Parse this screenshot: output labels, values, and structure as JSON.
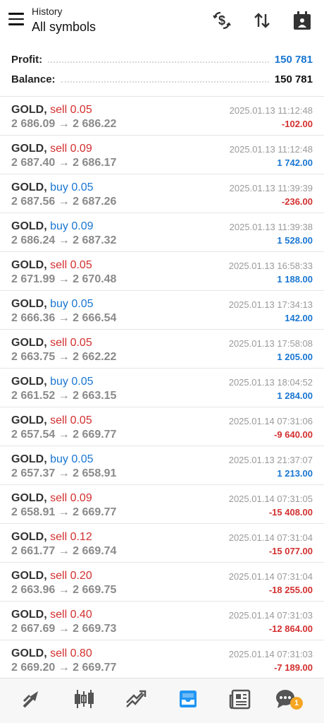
{
  "header": {
    "subtitle": "History",
    "title": "All symbols"
  },
  "summary": {
    "profit_label": "Profit:",
    "profit_value": "150 781",
    "balance_label": "Balance:",
    "balance_value": "150 781"
  },
  "deals": [
    {
      "symbol": "GOLD,",
      "side": "sell 0.05",
      "type": "sell",
      "prices": "2 686.09 → 2 686.22",
      "time": "2025.01.13 11:12:48",
      "pl": "-102.00",
      "pl_sign": "neg"
    },
    {
      "symbol": "GOLD,",
      "side": "sell 0.09",
      "type": "sell",
      "prices": "2 687.40 → 2 686.17",
      "time": "2025.01.13 11:12:48",
      "pl": "1 742.00",
      "pl_sign": "pos"
    },
    {
      "symbol": "GOLD,",
      "side": "buy 0.05",
      "type": "buy",
      "prices": "2 687.56 → 2 687.26",
      "time": "2025.01.13 11:39:39",
      "pl": "-236.00",
      "pl_sign": "neg"
    },
    {
      "symbol": "GOLD,",
      "side": "buy 0.09",
      "type": "buy",
      "prices": "2 686.24 → 2 687.32",
      "time": "2025.01.13 11:39:38",
      "pl": "1 528.00",
      "pl_sign": "pos"
    },
    {
      "symbol": "GOLD,",
      "side": "sell 0.05",
      "type": "sell",
      "prices": "2 671.99 → 2 670.48",
      "time": "2025.01.13 16:58:33",
      "pl": "1 188.00",
      "pl_sign": "pos"
    },
    {
      "symbol": "GOLD,",
      "side": "buy 0.05",
      "type": "buy",
      "prices": "2 666.36 → 2 666.54",
      "time": "2025.01.13 17:34:13",
      "pl": "142.00",
      "pl_sign": "pos"
    },
    {
      "symbol": "GOLD,",
      "side": "sell 0.05",
      "type": "sell",
      "prices": "2 663.75 → 2 662.22",
      "time": "2025.01.13 17:58:08",
      "pl": "1 205.00",
      "pl_sign": "pos"
    },
    {
      "symbol": "GOLD,",
      "side": "buy 0.05",
      "type": "buy",
      "prices": "2 661.52 → 2 663.15",
      "time": "2025.01.13 18:04:52",
      "pl": "1 284.00",
      "pl_sign": "pos"
    },
    {
      "symbol": "GOLD,",
      "side": "sell 0.05",
      "type": "sell",
      "prices": "2 657.54 → 2 669.77",
      "time": "2025.01.14 07:31:06",
      "pl": "-9 640.00",
      "pl_sign": "neg"
    },
    {
      "symbol": "GOLD,",
      "side": "buy 0.05",
      "type": "buy",
      "prices": "2 657.37 → 2 658.91",
      "time": "2025.01.13 21:37:07",
      "pl": "1 213.00",
      "pl_sign": "pos"
    },
    {
      "symbol": "GOLD,",
      "side": "sell 0.09",
      "type": "sell",
      "prices": "2 658.91 → 2 669.77",
      "time": "2025.01.14 07:31:05",
      "pl": "-15 408.00",
      "pl_sign": "neg"
    },
    {
      "symbol": "GOLD,",
      "side": "sell 0.12",
      "type": "sell",
      "prices": "2 661.77 → 2 669.74",
      "time": "2025.01.14 07:31:04",
      "pl": "-15 077.00",
      "pl_sign": "neg"
    },
    {
      "symbol": "GOLD,",
      "side": "sell 0.20",
      "type": "sell",
      "prices": "2 663.96 → 2 669.75",
      "time": "2025.01.14 07:31:04",
      "pl": "-18 255.00",
      "pl_sign": "neg"
    },
    {
      "symbol": "GOLD,",
      "side": "sell 0.40",
      "type": "sell",
      "prices": "2 667.69 → 2 669.73",
      "time": "2025.01.14 07:31:03",
      "pl": "-12 864.00",
      "pl_sign": "neg"
    },
    {
      "symbol": "GOLD,",
      "side": "sell 0.80",
      "type": "sell",
      "prices": "2 669.20 → 2 669.77",
      "time": "2025.01.14 07:31:03",
      "pl": "-7 189.00",
      "pl_sign": "neg"
    }
  ],
  "bottom_nav": {
    "items": [
      "quotes-icon",
      "chart-icon",
      "trade-icon",
      "history-icon",
      "news-icon",
      "chat-icon"
    ],
    "active": "history-icon",
    "chat_badge": "1"
  },
  "colors": {
    "accent": "#1976d2",
    "sell": "#d32f2f",
    "buy": "#1976d2",
    "badge": "#f5a623"
  }
}
